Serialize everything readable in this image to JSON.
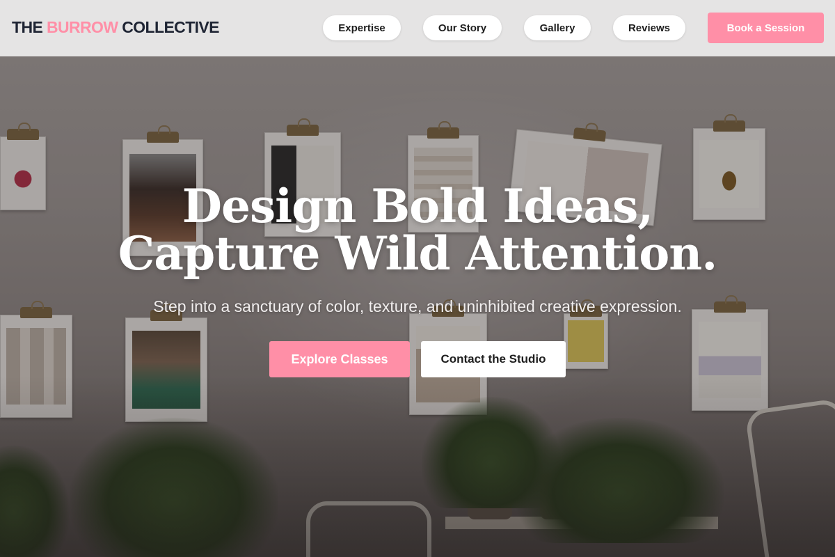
{
  "brand": {
    "part1": "THE ",
    "part2": "BURROW",
    "part3": " COLLECTIVE"
  },
  "nav": {
    "items": [
      {
        "label": "Expertise"
      },
      {
        "label": "Our Story"
      },
      {
        "label": "Gallery"
      },
      {
        "label": "Reviews"
      }
    ],
    "cta": "Book a Session"
  },
  "hero": {
    "title_line1": "Design Bold Ideas,",
    "title_line2": "Capture Wild Attention.",
    "subtitle": "Step into a sanctuary of color, texture, and uninhibited creative expression.",
    "primary_button": "Explore Classes",
    "secondary_button": "Contact the Studio"
  },
  "colors": {
    "accent": "#ff8fa7",
    "brand_dark": "#1e2433",
    "nav_bg": "#eeeeee",
    "white": "#ffffff"
  }
}
